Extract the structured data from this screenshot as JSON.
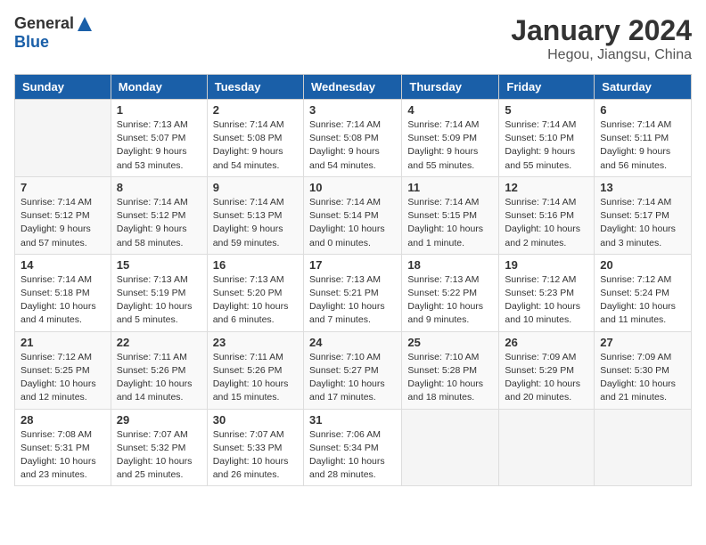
{
  "logo": {
    "general": "General",
    "blue": "Blue"
  },
  "title": "January 2024",
  "location": "Hegou, Jiangsu, China",
  "days_header": [
    "Sunday",
    "Monday",
    "Tuesday",
    "Wednesday",
    "Thursday",
    "Friday",
    "Saturday"
  ],
  "weeks": [
    [
      {
        "day": "",
        "info": ""
      },
      {
        "day": "1",
        "info": "Sunrise: 7:13 AM\nSunset: 5:07 PM\nDaylight: 9 hours\nand 53 minutes."
      },
      {
        "day": "2",
        "info": "Sunrise: 7:14 AM\nSunset: 5:08 PM\nDaylight: 9 hours\nand 54 minutes."
      },
      {
        "day": "3",
        "info": "Sunrise: 7:14 AM\nSunset: 5:08 PM\nDaylight: 9 hours\nand 54 minutes."
      },
      {
        "day": "4",
        "info": "Sunrise: 7:14 AM\nSunset: 5:09 PM\nDaylight: 9 hours\nand 55 minutes."
      },
      {
        "day": "5",
        "info": "Sunrise: 7:14 AM\nSunset: 5:10 PM\nDaylight: 9 hours\nand 55 minutes."
      },
      {
        "day": "6",
        "info": "Sunrise: 7:14 AM\nSunset: 5:11 PM\nDaylight: 9 hours\nand 56 minutes."
      }
    ],
    [
      {
        "day": "7",
        "info": "Sunrise: 7:14 AM\nSunset: 5:12 PM\nDaylight: 9 hours\nand 57 minutes."
      },
      {
        "day": "8",
        "info": "Sunrise: 7:14 AM\nSunset: 5:12 PM\nDaylight: 9 hours\nand 58 minutes."
      },
      {
        "day": "9",
        "info": "Sunrise: 7:14 AM\nSunset: 5:13 PM\nDaylight: 9 hours\nand 59 minutes."
      },
      {
        "day": "10",
        "info": "Sunrise: 7:14 AM\nSunset: 5:14 PM\nDaylight: 10 hours\nand 0 minutes."
      },
      {
        "day": "11",
        "info": "Sunrise: 7:14 AM\nSunset: 5:15 PM\nDaylight: 10 hours\nand 1 minute."
      },
      {
        "day": "12",
        "info": "Sunrise: 7:14 AM\nSunset: 5:16 PM\nDaylight: 10 hours\nand 2 minutes."
      },
      {
        "day": "13",
        "info": "Sunrise: 7:14 AM\nSunset: 5:17 PM\nDaylight: 10 hours\nand 3 minutes."
      }
    ],
    [
      {
        "day": "14",
        "info": "Sunrise: 7:14 AM\nSunset: 5:18 PM\nDaylight: 10 hours\nand 4 minutes."
      },
      {
        "day": "15",
        "info": "Sunrise: 7:13 AM\nSunset: 5:19 PM\nDaylight: 10 hours\nand 5 minutes."
      },
      {
        "day": "16",
        "info": "Sunrise: 7:13 AM\nSunset: 5:20 PM\nDaylight: 10 hours\nand 6 minutes."
      },
      {
        "day": "17",
        "info": "Sunrise: 7:13 AM\nSunset: 5:21 PM\nDaylight: 10 hours\nand 7 minutes."
      },
      {
        "day": "18",
        "info": "Sunrise: 7:13 AM\nSunset: 5:22 PM\nDaylight: 10 hours\nand 9 minutes."
      },
      {
        "day": "19",
        "info": "Sunrise: 7:12 AM\nSunset: 5:23 PM\nDaylight: 10 hours\nand 10 minutes."
      },
      {
        "day": "20",
        "info": "Sunrise: 7:12 AM\nSunset: 5:24 PM\nDaylight: 10 hours\nand 11 minutes."
      }
    ],
    [
      {
        "day": "21",
        "info": "Sunrise: 7:12 AM\nSunset: 5:25 PM\nDaylight: 10 hours\nand 12 minutes."
      },
      {
        "day": "22",
        "info": "Sunrise: 7:11 AM\nSunset: 5:26 PM\nDaylight: 10 hours\nand 14 minutes."
      },
      {
        "day": "23",
        "info": "Sunrise: 7:11 AM\nSunset: 5:26 PM\nDaylight: 10 hours\nand 15 minutes."
      },
      {
        "day": "24",
        "info": "Sunrise: 7:10 AM\nSunset: 5:27 PM\nDaylight: 10 hours\nand 17 minutes."
      },
      {
        "day": "25",
        "info": "Sunrise: 7:10 AM\nSunset: 5:28 PM\nDaylight: 10 hours\nand 18 minutes."
      },
      {
        "day": "26",
        "info": "Sunrise: 7:09 AM\nSunset: 5:29 PM\nDaylight: 10 hours\nand 20 minutes."
      },
      {
        "day": "27",
        "info": "Sunrise: 7:09 AM\nSunset: 5:30 PM\nDaylight: 10 hours\nand 21 minutes."
      }
    ],
    [
      {
        "day": "28",
        "info": "Sunrise: 7:08 AM\nSunset: 5:31 PM\nDaylight: 10 hours\nand 23 minutes."
      },
      {
        "day": "29",
        "info": "Sunrise: 7:07 AM\nSunset: 5:32 PM\nDaylight: 10 hours\nand 25 minutes."
      },
      {
        "day": "30",
        "info": "Sunrise: 7:07 AM\nSunset: 5:33 PM\nDaylight: 10 hours\nand 26 minutes."
      },
      {
        "day": "31",
        "info": "Sunrise: 7:06 AM\nSunset: 5:34 PM\nDaylight: 10 hours\nand 28 minutes."
      },
      {
        "day": "",
        "info": ""
      },
      {
        "day": "",
        "info": ""
      },
      {
        "day": "",
        "info": ""
      }
    ]
  ]
}
